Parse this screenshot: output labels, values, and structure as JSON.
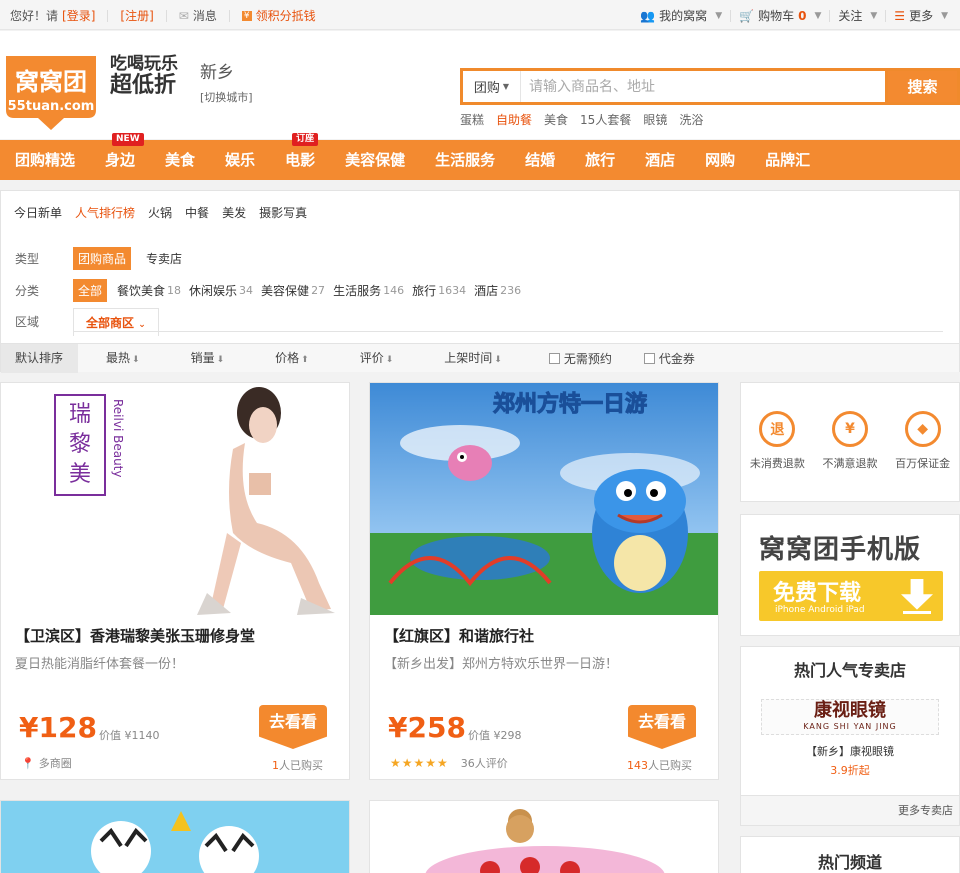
{
  "topbar": {
    "greeting": "您好！请",
    "login": "[登录]",
    "register": "[注册]",
    "messages": "消息",
    "points": "领积分抵钱",
    "my_account": "我的窝窝",
    "cart": "购物车",
    "cart_count": "0",
    "follow": "关注",
    "more": "更多"
  },
  "header": {
    "logo_text": "窝窝团",
    "logo_url_text": "55tuan.com",
    "slogan_line1": "吃喝玩乐",
    "slogan_line2": "超低折",
    "city": "新乡",
    "switch_city": "[切换城市]"
  },
  "search": {
    "type": "团购",
    "placeholder": "请输入商品名、地址",
    "button": "搜索",
    "hotwords": [
      "蛋糕",
      "自助餐",
      "美食",
      "15人套餐",
      "眼镜",
      "洗浴"
    ]
  },
  "nav": {
    "items": [
      "团购精选",
      "身边",
      "美食",
      "娱乐",
      "电影",
      "美容保健",
      "生活服务",
      "结婚",
      "旅行",
      "酒店",
      "网购",
      "品牌汇"
    ],
    "badge_new": "NEW",
    "badge_seat": "订座"
  },
  "filter": {
    "quick_links": [
      "今日新单",
      "人气排行榜",
      "火锅",
      "中餐",
      "美发",
      "摄影写真"
    ],
    "type_label": "类型",
    "type_options": [
      "团购商品",
      "专卖店"
    ],
    "category_label": "分类",
    "categories": [
      {
        "name": "全部",
        "count": ""
      },
      {
        "name": "餐饮美食",
        "count": "18"
      },
      {
        "name": "休闲娱乐",
        "count": "34"
      },
      {
        "name": "美容保健",
        "count": "27"
      },
      {
        "name": "生活服务",
        "count": "146"
      },
      {
        "name": "旅行",
        "count": "1634"
      },
      {
        "name": "酒店",
        "count": "236"
      }
    ],
    "region_label": "区域",
    "region_tab": "全部商区"
  },
  "sort": {
    "default": "默认排序",
    "options": [
      "最热",
      "销量",
      "价格",
      "评价",
      "上架时间"
    ],
    "checkboxes": [
      "无需预约",
      "代金券"
    ]
  },
  "deals": [
    {
      "title": "【卫滨区】香港瑞黎美张玉珊修身堂",
      "subtitle": "夏日热能消脂纤体套餐一份！",
      "price": "¥128",
      "worth": "价值 ¥1140",
      "go": "去看看",
      "location": "多商圈",
      "sold_count": "1",
      "sold_text": "人已购买",
      "brand_cn": "瑞黎美",
      "brand_en": "Reilvi Beauty"
    },
    {
      "title": "【红旗区】和谐旅行社",
      "subtitle": "【新乡出发】郑州方特欢乐世界一日游！",
      "price": "¥258",
      "worth": "价值 ¥298",
      "go": "去看看",
      "reviews": "36人评价",
      "stars": "★★★★★",
      "sold_count": "143",
      "sold_text": "人已购买",
      "banner": "郑州方特一日游"
    }
  ],
  "sidebar": {
    "guarantees": [
      {
        "icon": "退",
        "label": "未消费退款"
      },
      {
        "icon": "¥",
        "label": "不满意退款"
      },
      {
        "icon": "◆",
        "label": "百万保证金"
      }
    ],
    "mobile_title": "窝窝团手机版",
    "download": "免费下载",
    "platforms": "iPhone  Android  iPad",
    "shops_title": "热门人气专卖店",
    "shop_banner": "康视眼镜",
    "shop_banner_pinyin": "KANG SHI YAN JING",
    "shop_name": "【新乡】康视眼镜",
    "shop_discount": "3.9折起",
    "more_shops": "更多专卖店",
    "channel_title": "热门频道"
  },
  "colors": {
    "brand": "#f38a30",
    "price": "#f05f14",
    "accent_text": "#e8530e"
  }
}
